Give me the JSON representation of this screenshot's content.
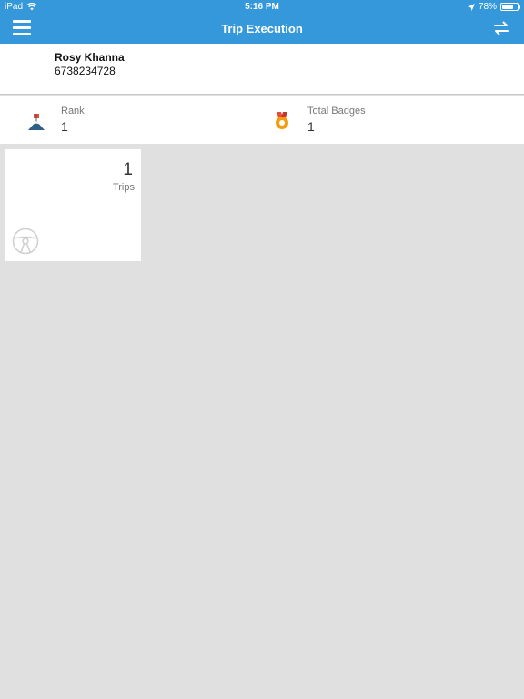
{
  "status_bar": {
    "device": "iPad",
    "time": "5:16 PM",
    "battery": "78%",
    "battery_level": 0.78,
    "icons": [
      "wifi-icon",
      "location-arrow-icon",
      "battery-icon"
    ]
  },
  "nav": {
    "title": "Trip Execution",
    "menu_icon": "hamburger-menu-icon",
    "swap_icon": "swap-arrows-icon",
    "color": "#3498db"
  },
  "profile": {
    "name": "Rosy  Khanna",
    "phone": "6738234728"
  },
  "stats": {
    "rank": {
      "label": "Rank",
      "value": "1",
      "icon": "mountain-flag-icon"
    },
    "badges": {
      "label": "Total Badges",
      "value": "1",
      "icon": "medal-icon"
    }
  },
  "tiles": {
    "trips": {
      "count": "1",
      "label": "Trips",
      "icon": "steering-wheel-icon"
    }
  }
}
